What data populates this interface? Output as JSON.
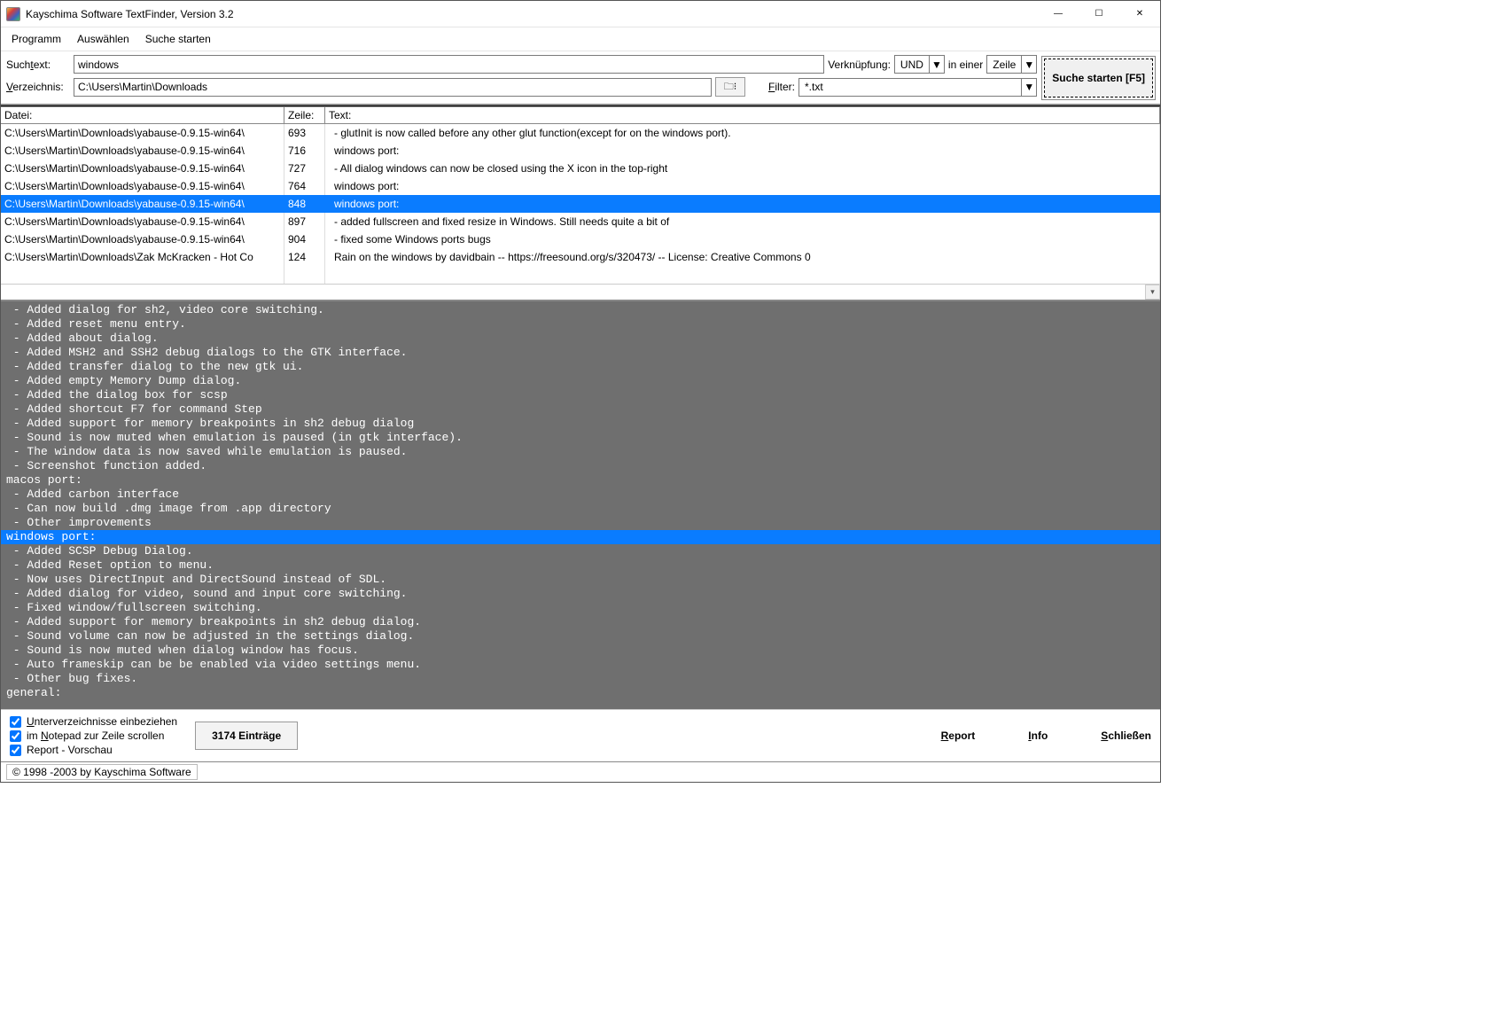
{
  "titlebar": {
    "title": "Kayschima Software TextFinder, Version 3.2"
  },
  "menu": {
    "items": [
      "Programm",
      "Auswählen",
      "Suche starten"
    ]
  },
  "search": {
    "suchtext_label": "Suchtext:",
    "suchtext_value": "windows",
    "verknupfung_label": "Verknüpfung:",
    "verknupfung_value": "UND",
    "in_einer": "in einer",
    "zeile": "Zeile",
    "verzeichnis_label": "Verzeichnis:",
    "verzeichnis_value": "C:\\Users\\Martin\\Downloads",
    "filter_label": "Filter:",
    "filter_value": "*.txt",
    "start_button": "Suche starten [F5]"
  },
  "columns": {
    "file": "Datei:",
    "line": "Zeile:",
    "text": "Text:"
  },
  "rows": [
    {
      "file": "C:\\Users\\Martin\\Downloads\\yabause-0.9.15-win64\\",
      "line": "693",
      "text": "   - glutInit is now called before any other glut function(except for on the windows port).",
      "sel": false
    },
    {
      "file": "C:\\Users\\Martin\\Downloads\\yabause-0.9.15-win64\\",
      "line": "716",
      "text": " windows port:",
      "sel": false
    },
    {
      "file": "C:\\Users\\Martin\\Downloads\\yabause-0.9.15-win64\\",
      "line": "727",
      "text": "   - All dialog windows can now be closed using the X icon in the top-right",
      "sel": false
    },
    {
      "file": "C:\\Users\\Martin\\Downloads\\yabause-0.9.15-win64\\",
      "line": "764",
      "text": " windows port:",
      "sel": false
    },
    {
      "file": "C:\\Users\\Martin\\Downloads\\yabause-0.9.15-win64\\",
      "line": "848",
      "text": " windows port:",
      "sel": true
    },
    {
      "file": "C:\\Users\\Martin\\Downloads\\yabause-0.9.15-win64\\",
      "line": "897",
      "text": "   - added fullscreen and fixed resize in Windows. Still needs quite a bit of",
      "sel": false
    },
    {
      "file": "C:\\Users\\Martin\\Downloads\\yabause-0.9.15-win64\\",
      "line": "904",
      "text": "   - fixed some Windows ports bugs",
      "sel": false
    },
    {
      "file": "C:\\Users\\Martin\\Downloads\\Zak McKracken - Hot Co",
      "line": "124",
      "text": "Rain on the windows by davidbain -- https://freesound.org/s/320473/ -- License: Creative Commons 0",
      "sel": false
    }
  ],
  "preview_lines": [
    " - Added dialog for sh2, video core switching.",
    " - Added reset menu entry.",
    " - Added about dialog.",
    " - Added MSH2 and SSH2 debug dialogs to the GTK interface.",
    " - Added transfer dialog to the new gtk ui.",
    " - Added empty Memory Dump dialog.",
    " - Added the dialog box for scsp",
    " - Added shortcut F7 for command Step",
    " - Added support for memory breakpoints in sh2 debug dialog",
    " - Sound is now muted when emulation is paused (in gtk interface).",
    " - The window data is now saved while emulation is paused.",
    " - Screenshot function added.",
    "macos port:",
    " - Added carbon interface",
    " - Can now build .dmg image from .app directory",
    " - Other improvements",
    {
      "text": "windows port:",
      "hl": true
    },
    " - Added SCSP Debug Dialog.",
    " - Added Reset option to menu.",
    " - Now uses DirectInput and DirectSound instead of SDL.",
    " - Added dialog for video, sound and input core switching.",
    " - Fixed window/fullscreen switching.",
    " - Added support for memory breakpoints in sh2 debug dialog.",
    " - Sound volume can now be adjusted in the settings dialog.",
    " - Sound is now muted when dialog window has focus.",
    " - Auto frameskip can be be enabled via video settings menu.",
    " - Other bug fixes.",
    "general:"
  ],
  "options": {
    "subdirs": "Unterverzeichnisse einbeziehen",
    "notepad": "im Notepad zur Zeile scrollen",
    "report_preview": "Report - Vorschau"
  },
  "entries_button": "3174 Einträge",
  "buttons": {
    "report": "Report",
    "info": "Info",
    "close": "Schließen"
  },
  "statusbar": "© 1998 -2003 by Kayschima Software"
}
